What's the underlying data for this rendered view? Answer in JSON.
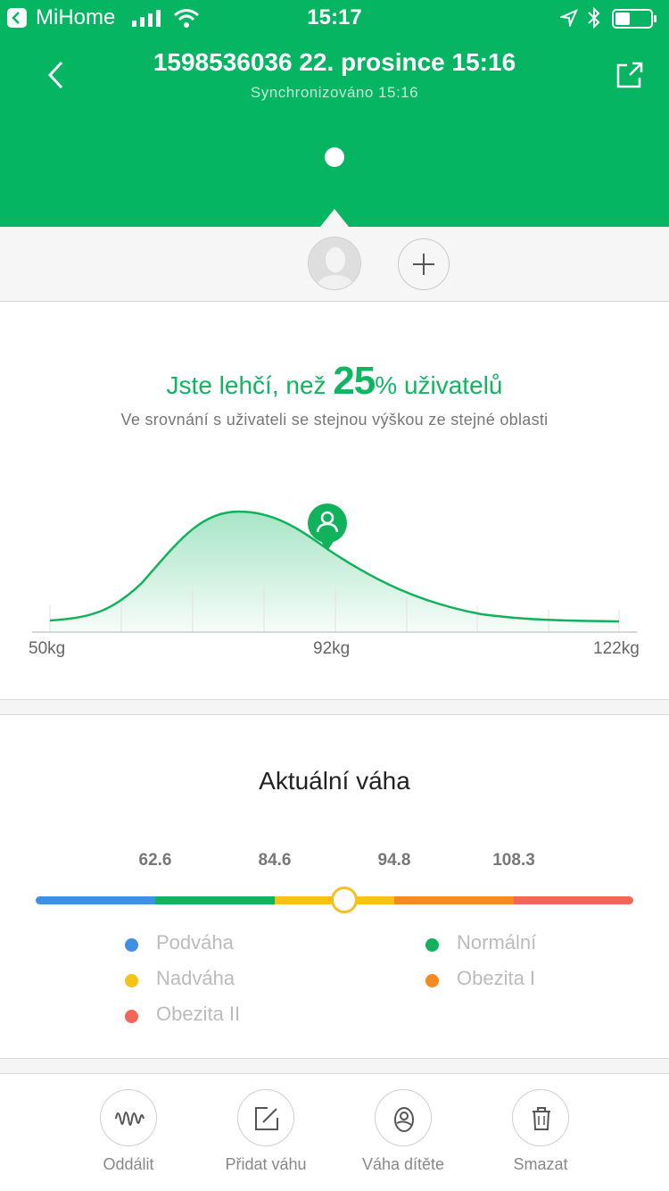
{
  "status_bar": {
    "app_name": "MiHome",
    "time": "15:17"
  },
  "header": {
    "title": "1598536036 22. prosince 15:16",
    "subtitle": "Synchronizováno 15:16",
    "background_color": "#06b561"
  },
  "comparison": {
    "title_prefix": "Jste lehčí, než ",
    "percent": "25",
    "title_suffix": "% uživatelů",
    "subtitle": "Ve srovnání s uživateli se stejnou výškou ze stejné oblasti",
    "accent_color": "#10b561",
    "axis_labels": [
      "50kg",
      "92kg",
      "122kg"
    ],
    "marker_icon": "user-location-pin-icon"
  },
  "weight": {
    "title": "Aktuální váha",
    "thresholds": [
      "62.6",
      "84.6",
      "94.8",
      "108.3"
    ],
    "segment_colors": [
      "#3f8fe6",
      "#12b25d",
      "#f7c216",
      "#f58a1f",
      "#f4665a"
    ],
    "current_position_fraction": 0.516,
    "legend": [
      {
        "label": "Podváha",
        "color": "#3f8fe6"
      },
      {
        "label": "Normální",
        "color": "#12b25d"
      },
      {
        "label": "Nadváha",
        "color": "#f7c216"
      },
      {
        "label": "Obezita I",
        "color": "#f58a1f"
      },
      {
        "label": "Obezita II",
        "color": "#f4665a"
      }
    ]
  },
  "toolbar": {
    "items": [
      {
        "label": "Oddálit",
        "icon": "waveform-icon"
      },
      {
        "label": "Přidat váhu",
        "icon": "edit-icon"
      },
      {
        "label": "Váha dítěte",
        "icon": "baby-icon"
      },
      {
        "label": "Smazat",
        "icon": "trash-icon"
      }
    ]
  }
}
